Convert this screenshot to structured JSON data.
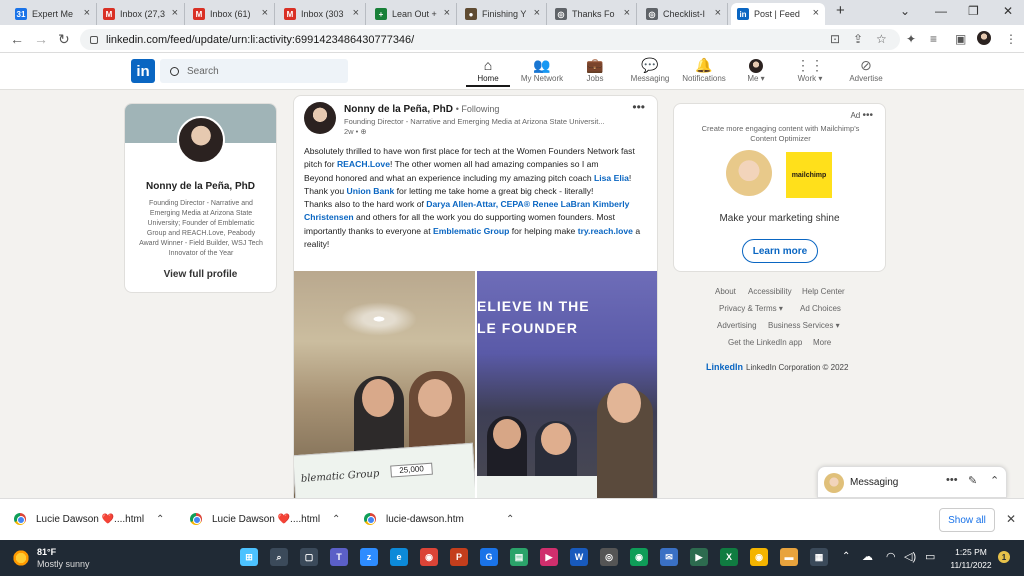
{
  "browser": {
    "tabs": [
      {
        "label": "Expert Me",
        "icon": "calendar-icon",
        "color": "#1a73e8",
        "glyph": "31"
      },
      {
        "label": "Inbox (27,3",
        "icon": "gmail-icon",
        "color": "#d93025",
        "glyph": "M"
      },
      {
        "label": "Inbox (61)",
        "icon": "gmail-icon",
        "color": "#d93025",
        "glyph": "M"
      },
      {
        "label": "Inbox (303",
        "icon": "gmail-icon",
        "color": "#d93025",
        "glyph": "M"
      },
      {
        "label": "Lean Out +",
        "icon": "sheets-icon",
        "color": "#188038",
        "glyph": "+"
      },
      {
        "label": "Finishing Y",
        "icon": "site-icon",
        "color": "#5f4b32",
        "glyph": "●"
      },
      {
        "label": "Thanks Fo",
        "icon": "globe-icon",
        "color": "#5f6368",
        "glyph": "◎"
      },
      {
        "label": "Checklist-I",
        "icon": "globe-icon",
        "color": "#5f6368",
        "glyph": "◎"
      },
      {
        "label": "Post | Feed",
        "icon": "linkedin-icon",
        "color": "#0a66c2",
        "glyph": "in"
      }
    ],
    "new_tab": "+",
    "url": "linkedin.com/feed/update/urn:li:activity:6991423486430777346/"
  },
  "linkedin": {
    "search_placeholder": "Search",
    "nav": [
      {
        "label": "Home",
        "glyph": "⌂",
        "active": true
      },
      {
        "label": "My Network",
        "glyph": "👥",
        "active": false
      },
      {
        "label": "Jobs",
        "glyph": "💼",
        "active": false
      },
      {
        "label": "Messaging",
        "glyph": "💬",
        "active": false
      },
      {
        "label": "Notifications",
        "glyph": "🔔",
        "active": false
      },
      {
        "label": "Me ▾",
        "glyph": "",
        "active": false
      },
      {
        "label": "Work ▾",
        "glyph": "⋮⋮",
        "active": false
      },
      {
        "label": "Advertise",
        "glyph": "⊘",
        "active": false
      }
    ],
    "profile": {
      "name": "Nonny de la Peña, PhD",
      "headline": "Founding Director - Narrative and Emerging Media at Arizona State University; Founder of Emblematic Group and REACH.Love, Peabody Award Winner - Field Builder, WSJ Tech Innovator of the Year",
      "view_profile": "View full profile"
    },
    "post": {
      "author": "Nonny de la Peña, PhD",
      "following": "• Following",
      "author_headline": "Founding Director - Narrative and Emerging Media at Arizona State Universit...",
      "time": "2w •",
      "more": "•••",
      "body": {
        "p1a": "Absolutely thrilled to have won first place for tech at the Women Founders Network fast pitch for ",
        "p1link": "REACH.Love",
        "p1b": "! The other women all had amazing companies so I am",
        "p2a": "Beyond honored and what an experience including my amazing pitch coach ",
        "p2link": "Lisa Elia",
        "p2b": "! Thank you ",
        "p2link2": "Union Bank",
        "p2c": " for letting me take home a great big check - literally!",
        "p3a": "Thanks also to the hard work of ",
        "p3link1": "Darya Allen-Attar, CEPA®",
        "p3link2": "Renee LaBran",
        "p3link3": "Kimberly Christensen",
        "p3b": " and others for all the work you do supporting women founders. Most importantly thanks to everyone at ",
        "p3link4": "Emblematic Group",
        "p3c": " for helping make ",
        "p3link5": "try.reach.love",
        "p3d": " a reality!"
      },
      "photo_right_banner": "ELIEVE IN THE\nLE FOUNDER",
      "photo_left_check": "blematic Group",
      "photo_left_amount": "25,000"
    },
    "ad": {
      "label": "Ad",
      "more": "•••",
      "text": "Create more engaging content with Mailchimp's Content Optimizer",
      "brand": "mailchimp",
      "tagline": "Make your marketing shine",
      "cta": "Learn more"
    },
    "footer": {
      "links": [
        "About",
        "Accessibility",
        "Help Center",
        "Privacy & Terms ▾",
        "Ad Choices",
        "Advertising",
        "Business Services ▾",
        "Get the LinkedIn app",
        "More"
      ],
      "brand": "LinkedIn",
      "copyright": "LinkedIn Corporation © 2022"
    },
    "messaging": {
      "label": "Messaging",
      "more": "•••"
    }
  },
  "downloads": {
    "items": [
      "Lucie Dawson ❤️....html",
      "Lucie Dawson ❤️....html",
      "lucie-dawson.htm"
    ],
    "show_all": "Show all"
  },
  "taskbar": {
    "temp": "81°F",
    "weather": "Mostly sunny",
    "time": "1:25 PM",
    "date": "11/11/2022",
    "notifications": "1"
  }
}
